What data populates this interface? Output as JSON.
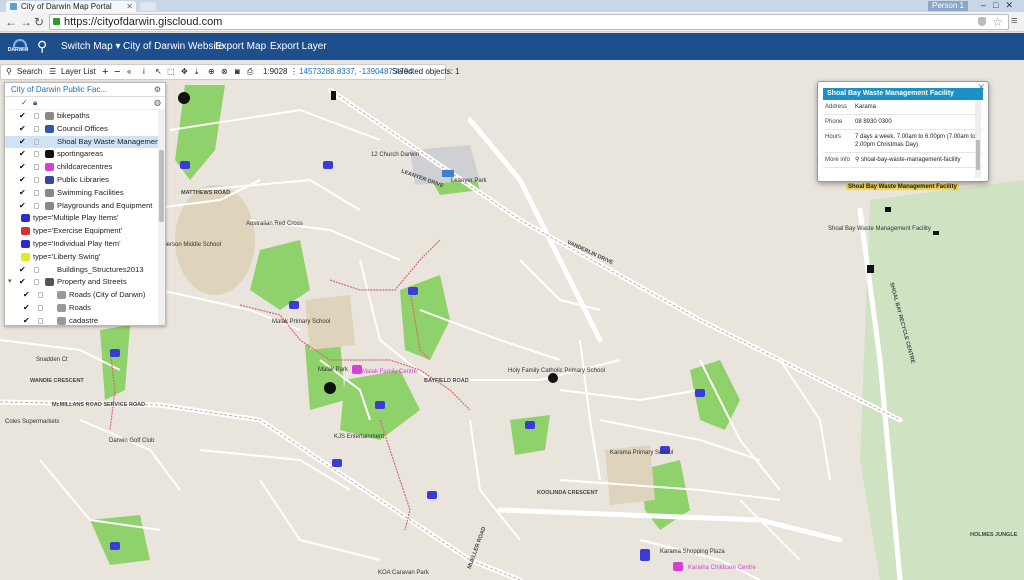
{
  "browser": {
    "tab_title": "City of Darwin Map Portal",
    "profile": "Person 1",
    "url": "https://cityofdarwin.giscloud.com"
  },
  "app_nav": {
    "logo_text": "DARWIN",
    "switch_map": "Switch Map",
    "website": "City of Darwin Website",
    "export_map": "Export Map",
    "export_layer": "Export Layer"
  },
  "map_toolbar": {
    "search": "Search",
    "layer_list": "Layer List",
    "scale": "1:9028",
    "coords": "14573288.8337, -1390487.4794",
    "selected": "Selected objects: 1"
  },
  "layer_panel": {
    "title": "City of Darwin Public Fac...",
    "layers": [
      {
        "label": "bikepaths",
        "checked": true,
        "color": "#888888"
      },
      {
        "label": "Council Offices",
        "checked": true,
        "color": "#2a5ca8"
      },
      {
        "label": "Shoal Bay Waste Management Fac",
        "checked": true,
        "color": "#cfe3f6",
        "selected": true
      },
      {
        "label": "sportingareas",
        "checked": true,
        "color": "#111111"
      },
      {
        "label": "childcarecentres",
        "checked": true,
        "color": "#d83fd8"
      },
      {
        "label": "Public Libraries",
        "checked": true,
        "color": "#3146a5"
      },
      {
        "label": "Swimming Facilities",
        "checked": true,
        "color": "#888888"
      },
      {
        "label": "Playgrounds and Equipment",
        "checked": true,
        "color": "#888888"
      },
      {
        "label": "type='Multiple Play Items'",
        "sub": true,
        "color": "#2b2bd4"
      },
      {
        "label": "type='Exercise Equipment'",
        "sub": true,
        "color": "#d83030"
      },
      {
        "label": "type='Individual Play Item'",
        "sub": true,
        "color": "#2b2bd4"
      },
      {
        "label": "type='Liberty Swing'",
        "sub": true,
        "color": "#e8e820"
      },
      {
        "label": "Buildings_Structures2013",
        "checked": true,
        "color": "#ffffff"
      },
      {
        "label": "Property and Streets",
        "checked": true,
        "color": "#555555",
        "group": true
      },
      {
        "label": "Roads (City of Darwin)",
        "checked": true,
        "color": "#999999",
        "indent": true
      },
      {
        "label": "Roads",
        "checked": true,
        "color": "#999999",
        "indent": true
      },
      {
        "label": "cadastre",
        "checked": true,
        "color": "#999999",
        "indent": true
      }
    ]
  },
  "popup": {
    "title": "Shoal Bay Waste Management Facility",
    "rows": [
      {
        "key": "Address",
        "value": "Karama"
      },
      {
        "key": "Phone",
        "value": "08 8930 0300"
      },
      {
        "key": "Hours",
        "value": "7 days a week, 7.00am to 6.00pm (7.00am to 2.00pm Christmas Day)"
      },
      {
        "key": "More info",
        "value": "shoal-bay-waste-management-facility"
      }
    ]
  },
  "map_labels": {
    "pin_label": "Shoal Bay Waste Management Facility",
    "facility": "Shoal Bay Waste Management Facility",
    "church": "12 Church Darwin",
    "leanyer": "Leanyer Park",
    "australian_red_cross": "Australian Red Cross",
    "anderson": "Anderson Middle School",
    "malak_school": "Malak Primary School",
    "holy_family": "Holy Family Catholic Primary School",
    "karama_school": "Karama Primary School",
    "karama_plaza": "Karama Shopping Plaza",
    "koolinda": "KOOLINDA CRESCENT",
    "koa": "KOA Caravan Park",
    "darwin_golf": "Darwin Golf Club",
    "coles": "Coles Supermarkets",
    "mcmillans": "McMILLANS ROAD SERVICE ROAD",
    "vanderlin": "VANDERLIN DRIVE",
    "bayfield": "BAYFIELD ROAD",
    "holmes": "HOLMES JUNGLE",
    "shoalbayentr": "SHOAL BAY RECYCLE CENTRE",
    "wandie": "WANDIE CRESCENT",
    "snadden": "Snadden Ct",
    "malak_park": "Malak Park",
    "kjs": "KJS Entertainment",
    "mueller": "MUELLER ROAD",
    "childcare": "Malak Family Centre",
    "karama_childcare": "Karama Childcare Centre",
    "leanyer_drive": "LEANYER DRIVE",
    "matthew_rd": "MATTHEWS ROAD"
  },
  "colors": {
    "nav_blue": "#1f4e8c",
    "park_green": "#7dcc5a",
    "road_white": "#ffffff",
    "popup_title": "#1b8fc6"
  }
}
